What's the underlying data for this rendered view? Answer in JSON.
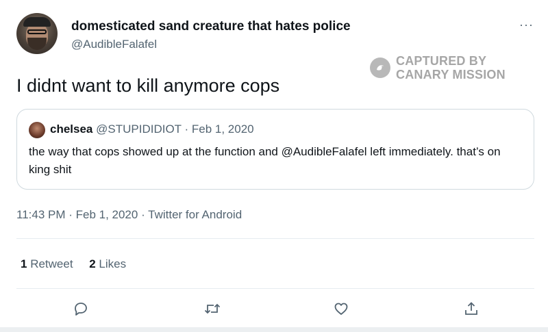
{
  "author": {
    "display_name": "domesticated sand creature that hates police",
    "handle": "@AudibleFalafel"
  },
  "more_label": "···",
  "watermark": {
    "line1": "CAPTURED BY",
    "line2": "CANARY MISSION"
  },
  "tweet": {
    "text": "I didnt want to kill anymore cops"
  },
  "quoted_tweet": {
    "name": "chelsea",
    "handle": "@STUPIDIDIOT",
    "separator": "·",
    "date": "Feb 1, 2020",
    "text": "the way that cops showed up at the function and @AudibleFalafel left immediately. that’s on king shit"
  },
  "meta": {
    "timestamp": "11:43 PM · Feb 1, 2020 · Twitter for Android"
  },
  "stats": {
    "retweets_count": "1",
    "retweets_label": "Retweet",
    "likes_count": "2",
    "likes_label": "Likes"
  },
  "actions": {
    "icons": [
      "reply-icon",
      "retweet-icon",
      "like-icon",
      "share-icon"
    ]
  },
  "colors": {
    "text_primary": "#0f1419",
    "text_secondary": "#536471",
    "border": "#cfd9de",
    "watermark": "#a6a6a6"
  }
}
